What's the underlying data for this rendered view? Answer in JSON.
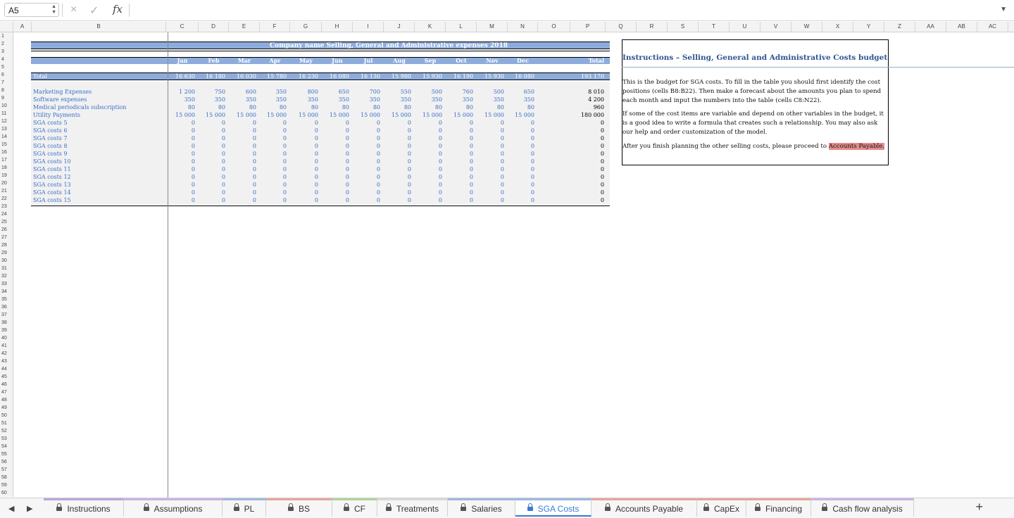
{
  "formula_bar": {
    "cell_ref": "A5",
    "cancel_icon": "×",
    "confirm_icon": "✓",
    "fx_label": "fx",
    "formula": ""
  },
  "columns": [
    "A",
    "B",
    "C",
    "D",
    "E",
    "F",
    "G",
    "H",
    "I",
    "J",
    "K",
    "L",
    "M",
    "N",
    "O",
    "P",
    "Q",
    "R",
    "S",
    "T",
    "U",
    "V",
    "W",
    "X",
    "Y",
    "Z",
    "AA",
    "AB",
    "AC"
  ],
  "rows_visible": 60,
  "sheet": {
    "title": "Company name Selling, General and Administrative expenses 2018",
    "months": [
      "Jan",
      "Feb",
      "Mar",
      "Apr",
      "May",
      "Jun",
      "Jul",
      "Aug",
      "Sep",
      "Oct",
      "Nov",
      "Dec"
    ],
    "total_header": "Total",
    "total_label": "Total",
    "totals": [
      "16 630",
      "16 180",
      "16 030",
      "15 780",
      "16 230",
      "16 080",
      "16 130",
      "15 980",
      "15 930",
      "16 190",
      "15 930",
      "16 080"
    ],
    "grand_total": "193 170",
    "items": [
      {
        "label": "Marketing Expenses",
        "values": [
          "1 200",
          "750",
          "600",
          "350",
          "800",
          "650",
          "700",
          "550",
          "500",
          "760",
          "500",
          "650"
        ],
        "total": "8 010"
      },
      {
        "label": "Software expenses",
        "values": [
          "350",
          "350",
          "350",
          "350",
          "350",
          "350",
          "350",
          "350",
          "350",
          "350",
          "350",
          "350"
        ],
        "total": "4 200"
      },
      {
        "label": "Medical periodicals subscription",
        "values": [
          "80",
          "80",
          "80",
          "80",
          "80",
          "80",
          "80",
          "80",
          "80",
          "80",
          "80",
          "80"
        ],
        "total": "960"
      },
      {
        "label": "Utility Payments",
        "values": [
          "15 000",
          "15 000",
          "15 000",
          "15 000",
          "15 000",
          "15 000",
          "15 000",
          "15 000",
          "15 000",
          "15 000",
          "15 000",
          "15 000"
        ],
        "total": "180 000"
      },
      {
        "label": "SGA costs 5",
        "values": [
          "0",
          "0",
          "0",
          "0",
          "0",
          "0",
          "0",
          "0",
          "0",
          "0",
          "0",
          "0"
        ],
        "total": "0"
      },
      {
        "label": "SGA costs 6",
        "values": [
          "0",
          "0",
          "0",
          "0",
          "0",
          "0",
          "0",
          "0",
          "0",
          "0",
          "0",
          "0"
        ],
        "total": "0"
      },
      {
        "label": "SGA costs 7",
        "values": [
          "0",
          "0",
          "0",
          "0",
          "0",
          "0",
          "0",
          "0",
          "0",
          "0",
          "0",
          "0"
        ],
        "total": "0"
      },
      {
        "label": "SGA costs 8",
        "values": [
          "0",
          "0",
          "0",
          "0",
          "0",
          "0",
          "0",
          "0",
          "0",
          "0",
          "0",
          "0"
        ],
        "total": "0"
      },
      {
        "label": "SGA costs 9",
        "values": [
          "0",
          "0",
          "0",
          "0",
          "0",
          "0",
          "0",
          "0",
          "0",
          "0",
          "0",
          "0"
        ],
        "total": "0"
      },
      {
        "label": "SGA costs 10",
        "values": [
          "0",
          "0",
          "0",
          "0",
          "0",
          "0",
          "0",
          "0",
          "0",
          "0",
          "0",
          "0"
        ],
        "total": "0"
      },
      {
        "label": "SGA costs 11",
        "values": [
          "0",
          "0",
          "0",
          "0",
          "0",
          "0",
          "0",
          "0",
          "0",
          "0",
          "0",
          "0"
        ],
        "total": "0"
      },
      {
        "label": "SGA costs 12",
        "values": [
          "0",
          "0",
          "0",
          "0",
          "0",
          "0",
          "0",
          "0",
          "0",
          "0",
          "0",
          "0"
        ],
        "total": "0"
      },
      {
        "label": "SGA costs 13",
        "values": [
          "0",
          "0",
          "0",
          "0",
          "0",
          "0",
          "0",
          "0",
          "0",
          "0",
          "0",
          "0"
        ],
        "total": "0"
      },
      {
        "label": "SGA costs 14",
        "values": [
          "0",
          "0",
          "0",
          "0",
          "0",
          "0",
          "0",
          "0",
          "0",
          "0",
          "0",
          "0"
        ],
        "total": "0"
      },
      {
        "label": "SGA costs 15",
        "values": [
          "0",
          "0",
          "0",
          "0",
          "0",
          "0",
          "0",
          "0",
          "0",
          "0",
          "0",
          "0"
        ],
        "total": "0"
      }
    ]
  },
  "instructions": {
    "title": "Instructions – Selling, General and Administrative Costs budget",
    "p1": "This is the budget for SGA costs. To fill in the table you should first identify the cost positions (cells B8:B22). Then make a forecast about the amounts you plan to spend each month and input the numbers into the table (cells C8:N22).",
    "p2": "If some of the cost items are variable and depend on other variables in the budget, it is a good idea to write a formula that creates such a relationship. You may also ask our help and order customization of the model.",
    "p3_prefix": "After you finish planning the other selling costs, please proceed to ",
    "p3_link": "Accounts Payable."
  },
  "tabs": [
    {
      "label": "Instructions",
      "color": "#b9a6d9"
    },
    {
      "label": "Assumptions",
      "color": "#c9b3e6"
    },
    {
      "label": "PL",
      "color": "#9cb8e0"
    },
    {
      "label": "BS",
      "color": "#e8a49c"
    },
    {
      "label": "CF",
      "color": "#a9d69a"
    },
    {
      "label": "Treatments",
      "color": "#d9d9d9"
    },
    {
      "label": "Salaries",
      "color": "#9cb8e0"
    },
    {
      "label": "SGA Costs",
      "color": "#9cb8e0",
      "active": true
    },
    {
      "label": "Accounts Payable",
      "color": "#e8a49c"
    },
    {
      "label": "CapEx",
      "color": "#e8a49c"
    },
    {
      "label": "Financing",
      "color": "#e8a49c"
    },
    {
      "label": "Cash flow analysis",
      "color": "#c9b3e6"
    }
  ],
  "colors": {
    "accent": "#3a7bd5",
    "band": "#8eacdb",
    "value_text": "#3a6fc8",
    "link_highlight": "#e58b8b"
  }
}
